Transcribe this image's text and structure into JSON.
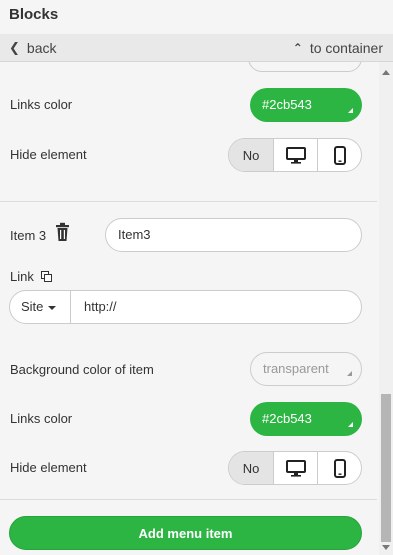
{
  "panel": {
    "title": "Blocks"
  },
  "nav": {
    "back_label": "back",
    "up_label": "to container"
  },
  "item_group_1": {
    "links_color_label": "Links color",
    "links_color_value": "#2cb543",
    "hide_element_label": "Hide element",
    "hide_options": {
      "no": "No",
      "desktop_icon": "monitor-icon",
      "mobile_icon": "phone-icon"
    },
    "hide_selected": "No"
  },
  "item_3": {
    "label": "Item 3",
    "delete_icon": "trash-icon",
    "name_value": "Item3",
    "link_label": "Link",
    "link_icon": "copy-icon",
    "link_type": "Site",
    "url_value": "http://",
    "background_label": "Background color of item",
    "background_value": "transparent",
    "links_color_label": "Links color",
    "links_color_value": "#2cb543",
    "hide_element_label": "Hide element",
    "hide_options": {
      "no": "No",
      "desktop_icon": "monitor-icon",
      "mobile_icon": "phone-icon"
    },
    "hide_selected": "No"
  },
  "actions": {
    "add_menu_item": "Add menu item"
  },
  "colors": {
    "accent": "#2cb543",
    "panel_bg": "#f5f5f5",
    "nav_bg": "#e9e9e9",
    "border": "#cccccc",
    "segment_active": "#e4e4e4"
  }
}
